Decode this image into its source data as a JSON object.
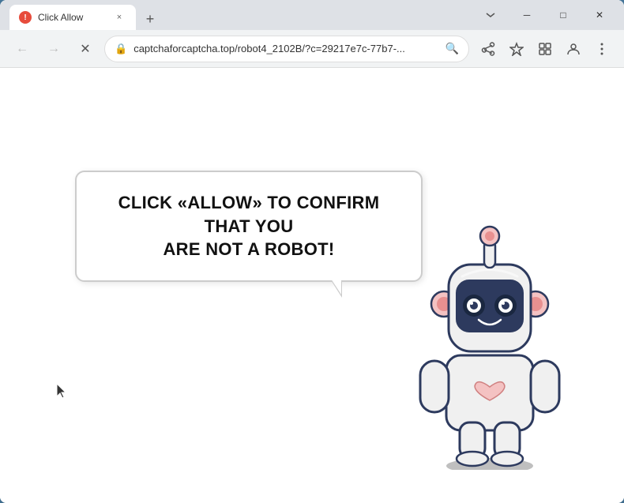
{
  "browser": {
    "tab": {
      "title": "Click Allow",
      "favicon_label": "!",
      "close_label": "×"
    },
    "new_tab_label": "+",
    "window_controls": {
      "minimize": "─",
      "maximize": "□",
      "close": "✕"
    },
    "nav": {
      "back_label": "←",
      "forward_label": "→",
      "reload_label": "✕",
      "address": "captchaforcaptcha.top/robot4_2102B/?c=29217e7c-77b7-...",
      "search_icon": "🔍",
      "share_icon": "⎙",
      "bookmark_icon": "☆",
      "extensions_icon": "□",
      "profile_icon": "⊙",
      "menu_icon": "⋮"
    }
  },
  "page": {
    "bubble_line1": "CLICK «ALLOW» TO CONFIRM THAT YOU",
    "bubble_line2": "ARE NOT A ROBOT!"
  }
}
